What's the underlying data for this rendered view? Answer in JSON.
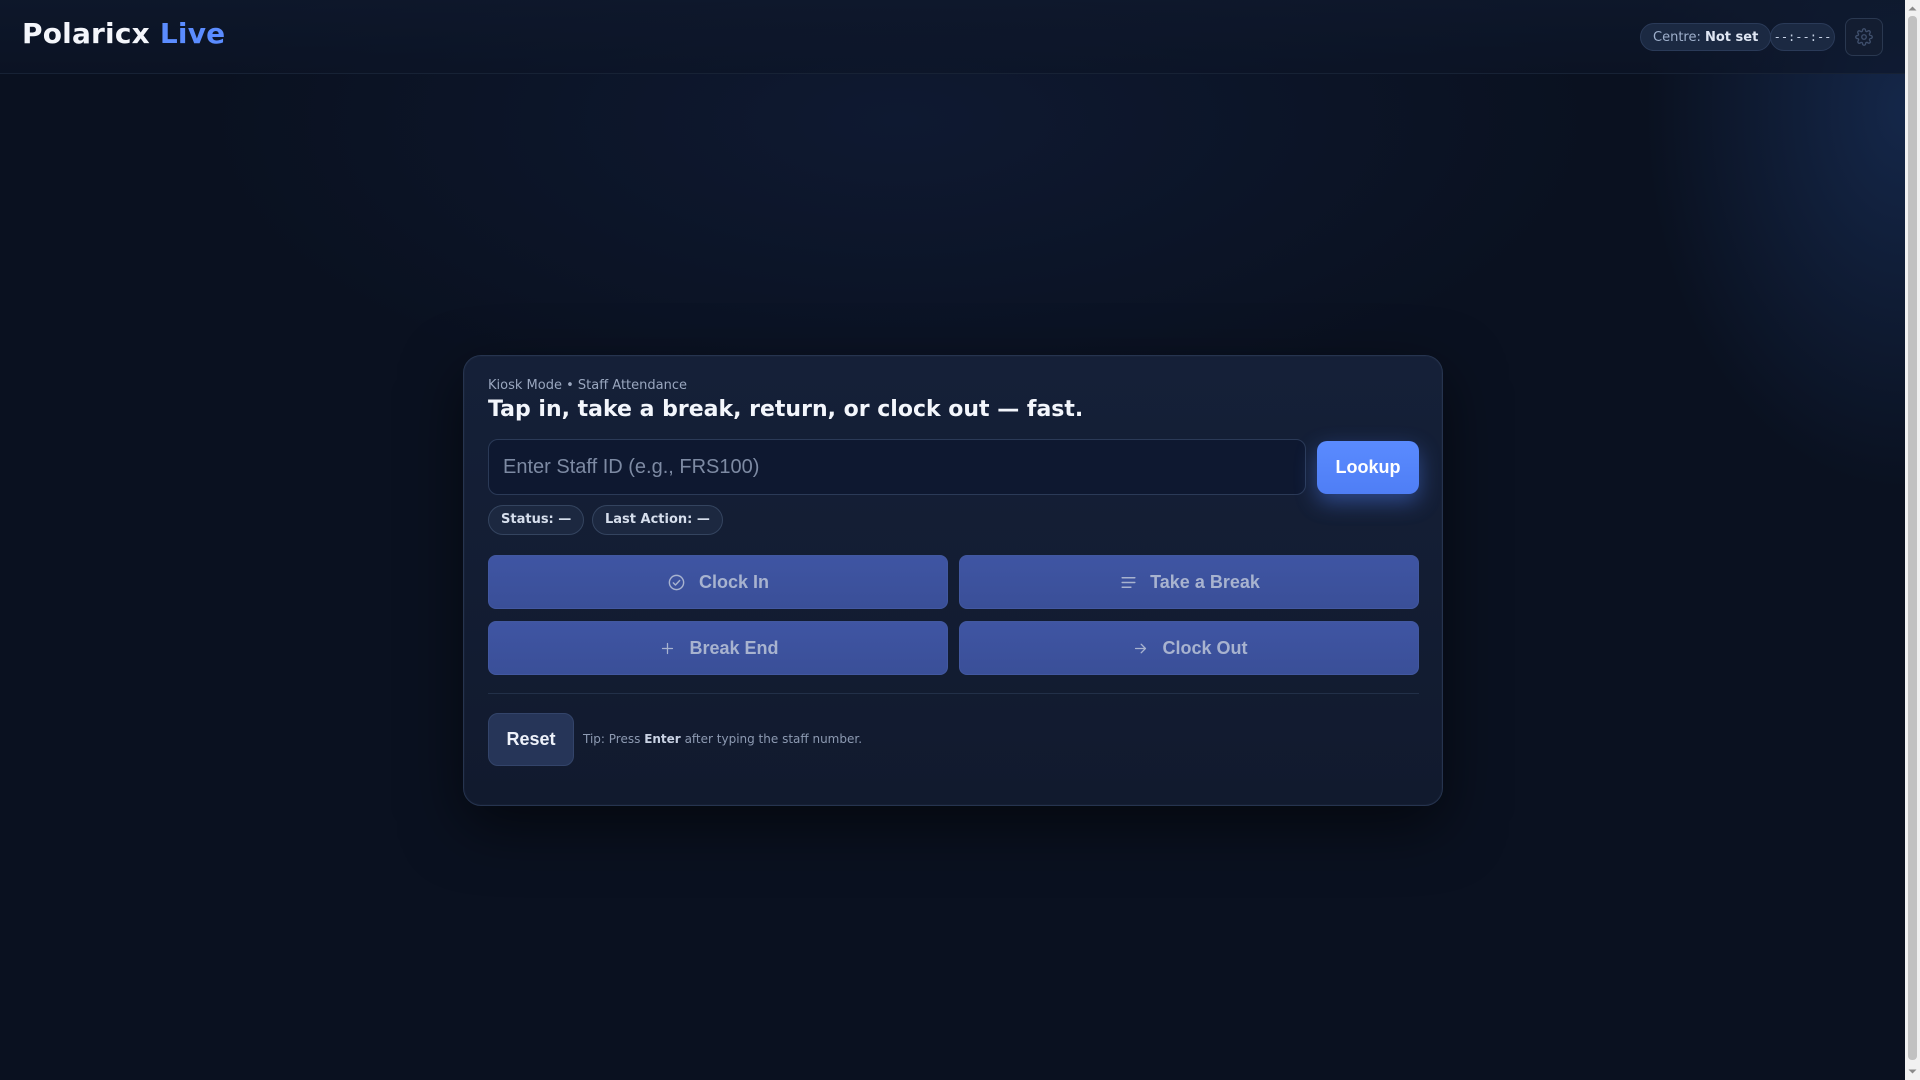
{
  "header": {
    "brand_name": "Polaricx",
    "brand_accent": "Live",
    "centre_label": "Centre:",
    "centre_value": "Not set",
    "clock": "--:--:--",
    "settings_icon": "gear-icon"
  },
  "kiosk": {
    "eyebrow": "Kiosk Mode • Staff Attendance",
    "headline": "Tap in, take a break, return, or clock out — fast.",
    "staff_input": {
      "value": "",
      "placeholder": "Enter Staff ID (e.g., FRS100)"
    },
    "lookup_label": "Lookup",
    "status_label": "Status:",
    "status_value": "—",
    "last_action_label": "Last Action:",
    "last_action_value": "—",
    "actions": {
      "clock_in": {
        "label": "Clock In",
        "icon": "check-circle-icon"
      },
      "take_break": {
        "label": "Take a Break",
        "icon": "lines-icon"
      },
      "break_end": {
        "label": "Break End",
        "icon": "plus-icon"
      },
      "clock_out": {
        "label": "Clock Out",
        "icon": "arrow-right-icon"
      }
    },
    "reset_label": "Reset",
    "tip_prefix": "Tip: Press",
    "tip_key": "Enter",
    "tip_suffix": "after typing the staff number."
  },
  "colors": {
    "accent": "#5b8cff",
    "background": "#0a1120",
    "action_button": "#3f55a3"
  }
}
